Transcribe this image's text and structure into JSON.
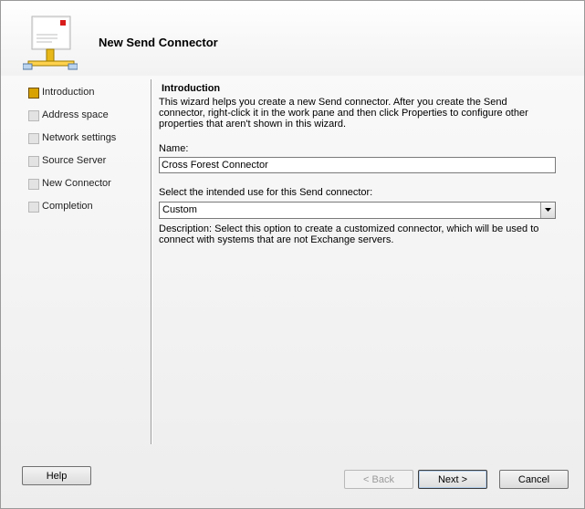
{
  "header": {
    "title": "New Send Connector",
    "icon": "send-connector-icon"
  },
  "nav": {
    "items": [
      {
        "label": "Introduction",
        "active": true
      },
      {
        "label": "Address space",
        "active": false
      },
      {
        "label": "Network settings",
        "active": false
      },
      {
        "label": "Source Server",
        "active": false
      },
      {
        "label": "New Connector",
        "active": false
      },
      {
        "label": "Completion",
        "active": false
      }
    ]
  },
  "content": {
    "section_title": "Introduction",
    "intro_text": "This wizard helps you create a new Send connector. After you create the Send connector, right-click it in the work pane and then click Properties to configure other properties that aren't shown in this wizard.",
    "name_label": "Name:",
    "name_value": "Cross Forest Connector",
    "use_label": "Select the intended use for this Send connector:",
    "use_value": "Custom",
    "description": "Description: Select this option to create a customized connector, which will be used to connect with systems that are not Exchange servers."
  },
  "buttons": {
    "help": "Help",
    "back": "< Back",
    "next": "Next >",
    "cancel": "Cancel"
  }
}
